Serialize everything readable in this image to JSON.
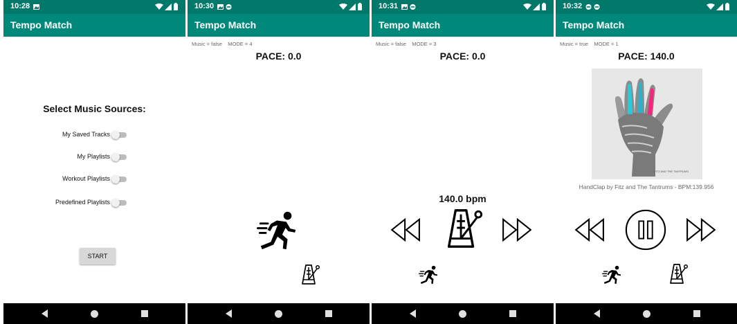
{
  "screens": [
    {
      "status": {
        "time": "10:28"
      },
      "appbar": {
        "title": "Tempo Match"
      },
      "heading": "Select Music Sources:",
      "toggles": [
        {
          "label": "My Saved Tracks",
          "on": false
        },
        {
          "label": "My Playlists",
          "on": false
        },
        {
          "label": "Workout Playlists",
          "on": false
        },
        {
          "label": "Predefined Playlists",
          "on": false
        }
      ],
      "start_label": "START"
    },
    {
      "status": {
        "time": "10:30"
      },
      "appbar": {
        "title": "Tempo Match"
      },
      "debug": "Music = false    MODE = 4",
      "pace": "PACE: 0.0",
      "icons": [
        "runner-icon",
        "metronome-icon"
      ]
    },
    {
      "status": {
        "time": "10:31"
      },
      "appbar": {
        "title": "Tempo Match"
      },
      "debug": "Music = false    MODE = 3",
      "pace": "PACE: 0.0",
      "bpm": "140.0 bpm",
      "icons": [
        "rewind-icon",
        "metronome-icon",
        "fast-forward-icon",
        "runner-icon"
      ]
    },
    {
      "status": {
        "time": "10:32"
      },
      "appbar": {
        "title": "Tempo Match"
      },
      "debug": "Music = true    MODE = 1",
      "pace": "PACE: 140.0",
      "album_caption": "FITZ AND THE TANTRUMS",
      "track": "HandClap by Fitz and The Tantrums - BPM:139.956",
      "icons": [
        "album-art",
        "rewind-icon",
        "pause-icon",
        "fast-forward-icon",
        "runner-icon",
        "metronome-icon"
      ]
    }
  ],
  "colors": {
    "status_bar": "#00796b",
    "app_bar": "#00897b",
    "nav_bar": "#000000",
    "toggle_track": "#bdbdbd",
    "toggle_knob": "#f1f1f1"
  }
}
